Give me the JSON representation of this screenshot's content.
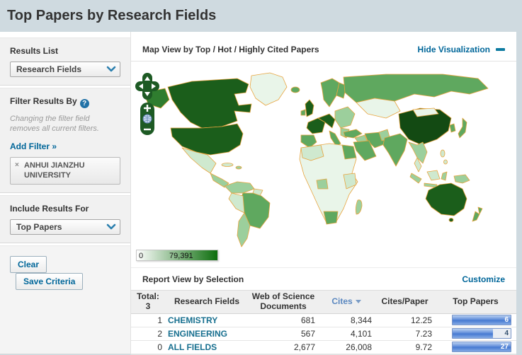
{
  "page": {
    "title": "Top Papers by Research Fields"
  },
  "sidebar": {
    "results_list_label": "Results List",
    "results_list_value": "Research Fields",
    "filter_label": "Filter Results By",
    "filter_help": "?",
    "filter_note": "Changing the filter field removes all current filters.",
    "add_filter": "Add Filter »",
    "filter_chip": {
      "remove": "×",
      "text": "ANHUI JIANZHU UNIVERSITY"
    },
    "include_label": "Include Results For",
    "include_value": "Top Papers",
    "clear_button": "Clear",
    "save_button": "Save Criteria"
  },
  "map_panel": {
    "title": "Map View by Top / Hot / Highly Cited Papers",
    "hide_link": "Hide Visualization",
    "legend_min": "0",
    "legend_max": "79,391",
    "legend_low_color": "#ffffff",
    "legend_high_color": "#0d6e0d",
    "country_border_color": "#e8a43e"
  },
  "report": {
    "title": "Report View by Selection",
    "customize": "Customize",
    "header": {
      "total_label": "Total:",
      "total_value": "3",
      "fields": "Research Fields",
      "docs": "Web of Science Documents",
      "cites": "Cites",
      "cites_per": "Cites/Paper",
      "top": "Top Papers"
    },
    "sorted_by": "Cites",
    "rows": [
      {
        "num": "1",
        "field": "CHEMISTRY",
        "docs": "681",
        "cites": "8,344",
        "cites_per": "12.25",
        "top": "6",
        "bar_pct": 100
      },
      {
        "num": "2",
        "field": "ENGINEERING",
        "docs": "567",
        "cites": "4,101",
        "cites_per": "7.23",
        "top": "4",
        "bar_pct": 70
      },
      {
        "num": "0",
        "field": "ALL FIELDS",
        "docs": "2,677",
        "cites": "26,008",
        "cites_per": "9.72",
        "top": "27",
        "bar_pct": 100
      }
    ]
  },
  "colors": {
    "page_header_bg": "#cfdae0",
    "link_blue": "#006699",
    "field_link": "#176f8f",
    "bar_blue": "#467ad2"
  }
}
